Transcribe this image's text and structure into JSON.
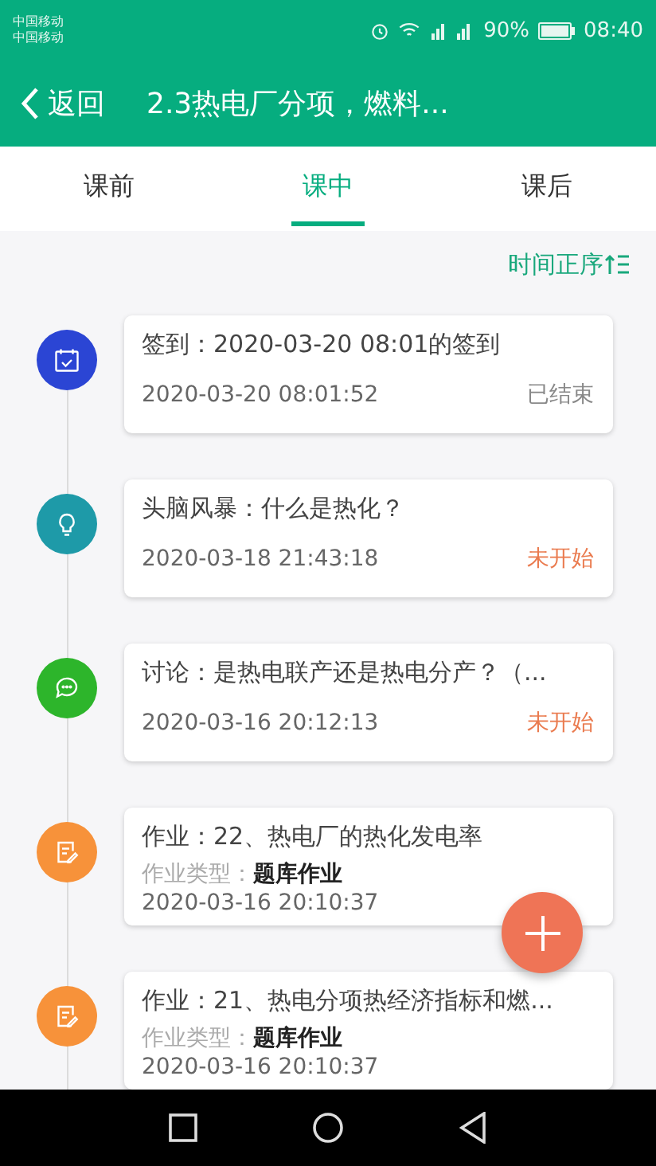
{
  "status_bar": {
    "carriers": [
      "中国移动",
      "中国移动"
    ],
    "battery": "90%",
    "time": "08:40"
  },
  "header": {
    "back": "返回",
    "title": "2.3热电厂分项，燃料..."
  },
  "tabs": [
    {
      "label": "课前",
      "selected": false
    },
    {
      "label": "课中",
      "selected": true
    },
    {
      "label": "课后",
      "selected": false
    }
  ],
  "sort": {
    "label": "时间正序"
  },
  "activities": [
    {
      "kind": "checkin",
      "color": "#2b45d4",
      "title": "签到：2020-03-20 08:01的签到",
      "time": "2020-03-20 08:01:52",
      "status": "已结束",
      "ended": true
    },
    {
      "kind": "brainstorm",
      "color": "#1e9aa8",
      "title": "头脑风暴：什么是热化？",
      "time": "2020-03-18 21:43:18",
      "status": "未开始",
      "ended": false
    },
    {
      "kind": "discussion",
      "color": "#2db52b",
      "title": "讨论：是热电联产还是热电分产？（...",
      "time": "2020-03-16 20:12:13",
      "status": "未开始",
      "ended": false
    },
    {
      "kind": "homework",
      "color": "#f7923a",
      "title": "作业：22、热电厂的热化发电率",
      "type_label": "作业类型：",
      "type_value": "题库作业",
      "time": "2020-03-16 20:10:37"
    },
    {
      "kind": "homework",
      "color": "#f7923a",
      "title": "作业：21、热电分项热经济指标和燃...",
      "type_label": "作业类型：",
      "type_value": "题库作业",
      "time": "2020-03-16 20:10:37"
    }
  ]
}
